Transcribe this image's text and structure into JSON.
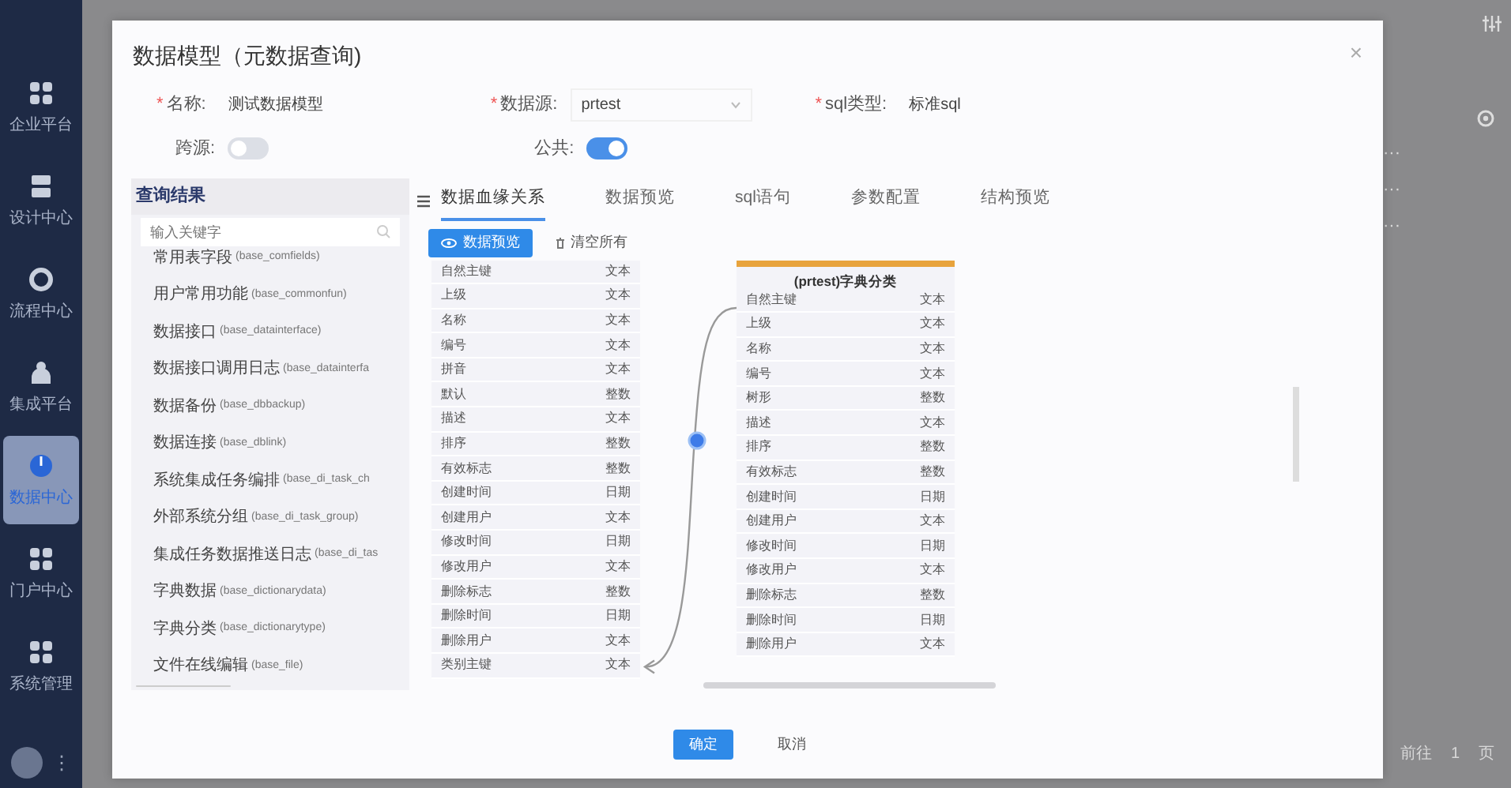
{
  "sidebar": {
    "items": [
      {
        "label": "企业平台",
        "selected": false
      },
      {
        "label": "设计中心",
        "selected": false
      },
      {
        "label": "流程中心",
        "selected": false
      },
      {
        "label": "集成平台",
        "selected": false
      },
      {
        "label": "数据中心",
        "selected": true
      },
      {
        "label": "门户中心",
        "selected": false
      },
      {
        "label": "系统管理",
        "selected": false
      }
    ],
    "more": "⋮"
  },
  "background": {
    "row_actions": [
      "···",
      "···",
      "···"
    ],
    "pagination": {
      "goto": "前往",
      "page": "1",
      "unit": "页"
    }
  },
  "dialog": {
    "title": "数据模型（元数据查询)",
    "close": "×",
    "fields": [
      {
        "mark": "*",
        "label": "名称:",
        "value": "测试数据模型",
        "kind": "text"
      },
      {
        "mark": "*",
        "label": "数据源:",
        "value": "prtest",
        "kind": "select"
      },
      {
        "mark": "*",
        "label": "sql类型:",
        "value": "标准sql",
        "kind": "text"
      }
    ],
    "toggles": [
      {
        "label": "跨源:",
        "on": false
      },
      {
        "label": "公共:",
        "on": true
      }
    ],
    "query_panel": {
      "title": "查询结果",
      "search_placeholder": "输入关键字",
      "items": [
        {
          "name": "常用表字段",
          "table": "(base_comfields)"
        },
        {
          "name": "用户常用功能",
          "table": "(base_commonfun)"
        },
        {
          "name": "数据接口",
          "table": "(base_datainterface)"
        },
        {
          "name": "数据接口调用日志",
          "table": "(base_datainterfa"
        },
        {
          "name": "数据备份",
          "table": "(base_dbbackup)"
        },
        {
          "name": "数据连接",
          "table": "(base_dblink)"
        },
        {
          "name": "系统集成任务编排",
          "table": "(base_di_task_ch"
        },
        {
          "name": "外部系统分组",
          "table": "(base_di_task_group)"
        },
        {
          "name": "集成任务数据推送日志",
          "table": "(base_di_tas"
        },
        {
          "name": "字典数据",
          "table": "(base_dictionarydata)"
        },
        {
          "name": "字典分类",
          "table": "(base_dictionarytype)"
        },
        {
          "name": "文件在线编辑",
          "table": "(base_file)"
        }
      ]
    },
    "tabs": [
      {
        "label": "数据血缘关系",
        "selected": true
      },
      {
        "label": "数据预览",
        "selected": false
      },
      {
        "label": "sql语句",
        "selected": false
      },
      {
        "label": "参数配置",
        "selected": false
      },
      {
        "label": "结构预览",
        "selected": false
      }
    ],
    "actions": [
      {
        "label": "数据预览",
        "kind": "primary"
      },
      {
        "label": "清空所有",
        "kind": "link"
      }
    ],
    "lineage": {
      "source_fields": [
        {
          "name": "自然主键",
          "type": "文本"
        },
        {
          "name": "上级",
          "type": "文本"
        },
        {
          "name": "名称",
          "type": "文本"
        },
        {
          "name": "编号",
          "type": "文本"
        },
        {
          "name": "拼音",
          "type": "文本"
        },
        {
          "name": "默认",
          "type": "整数"
        },
        {
          "name": "描述",
          "type": "文本"
        },
        {
          "name": "排序",
          "type": "整数"
        },
        {
          "name": "有效标志",
          "type": "整数"
        },
        {
          "name": "创建时间",
          "type": "日期"
        },
        {
          "name": "创建用户",
          "type": "文本"
        },
        {
          "name": "修改时间",
          "type": "日期"
        },
        {
          "name": "修改用户",
          "type": "文本"
        },
        {
          "name": "删除标志",
          "type": "整数"
        },
        {
          "name": "删除时间",
          "type": "日期"
        },
        {
          "name": "删除用户",
          "type": "文本"
        },
        {
          "name": "类别主键",
          "type": "文本"
        }
      ],
      "target": {
        "title": "(prtest)字典分类",
        "fields": [
          {
            "name": "自然主键",
            "type": "文本"
          },
          {
            "name": "上级",
            "type": "文本"
          },
          {
            "name": "名称",
            "type": "文本"
          },
          {
            "name": "编号",
            "type": "文本"
          },
          {
            "name": "树形",
            "type": "整数"
          },
          {
            "name": "描述",
            "type": "文本"
          },
          {
            "name": "排序",
            "type": "整数"
          },
          {
            "name": "有效标志",
            "type": "整数"
          },
          {
            "name": "创建时间",
            "type": "日期"
          },
          {
            "name": "创建用户",
            "type": "文本"
          },
          {
            "name": "修改时间",
            "type": "日期"
          },
          {
            "name": "修改用户",
            "type": "文本"
          },
          {
            "name": "删除标志",
            "type": "整数"
          },
          {
            "name": "删除时间",
            "type": "日期"
          },
          {
            "name": "删除用户",
            "type": "文本"
          }
        ]
      }
    },
    "buttons": [
      {
        "label": "确定",
        "kind": "primary"
      },
      {
        "label": "取消",
        "kind": "plain"
      }
    ]
  }
}
